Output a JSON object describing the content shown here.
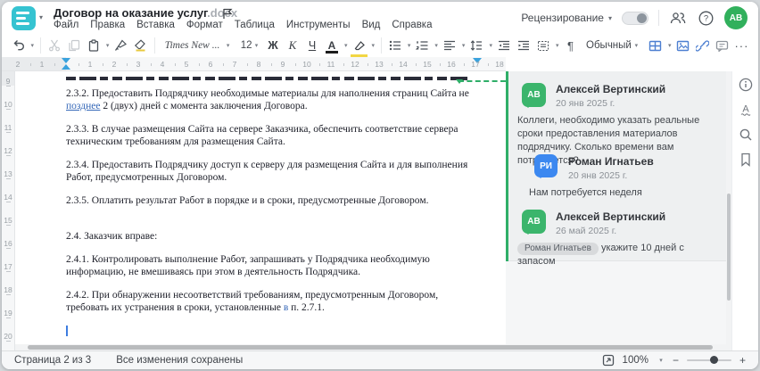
{
  "header": {
    "title": "Договор на оказание услуг",
    "title_extension": ".docx",
    "menu": [
      "Файл",
      "Правка",
      "Вставка",
      "Формат",
      "Таблица",
      "Инструменты",
      "Вид",
      "Справка"
    ],
    "review_label": "Рецензирование",
    "avatar_initials": "АВ"
  },
  "toolbar": {
    "font_name": "Times New ...",
    "font_size": "12",
    "bold_label": "Ж",
    "italic_label": "К",
    "underline_label": "Ч",
    "font_color_label": "А",
    "pilcrow_label": "¶",
    "style_name": "Обычный",
    "more_label": "···",
    "caret_glyph": "▾"
  },
  "ruler": {
    "horizontal_margin_numbers": [
      "2",
      "1"
    ],
    "horizontal_numbers": [
      "1",
      "2",
      "3",
      "4",
      "5",
      "6",
      "7",
      "8",
      "9",
      "10",
      "11",
      "12",
      "13",
      "14",
      "15",
      "16",
      "17",
      "18"
    ],
    "vertical_numbers": [
      "9",
      "10",
      "11",
      "12",
      "13",
      "14",
      "15",
      "16",
      "17",
      "18",
      "19",
      "20"
    ]
  },
  "document": {
    "para_232": {
      "pre": "2.3.2. Предоставить Подрядчику необходимые материалы для наполнения страниц Сайта не ",
      "inserted": "позднее",
      "post": " 2 (двух) дней с момента заключения Договора."
    },
    "para_233": "2.3.3. В случае размещения Сайта на сервере Заказчика, обеспечить соответствие сервера техническим требованиям для размещения Сайта.",
    "para_234": "2.3.4. Предоставить Подрядчику доступ к серверу для размещения Сайта и для выполнения Работ, предусмотренных Договором.",
    "para_235": "2.3.5. Оплатить результат Работ в порядке и в сроки, предусмотренные Договором.",
    "para_24": "2.4. Заказчик вправе:",
    "para_241": "2.4.1. Контролировать выполнение Работ, запрашивать у Подрядчика необходимую информацию, не вмешиваясь при этом в деятельность Подрядчика.",
    "para_242": {
      "pre": "2.4.2. При обнаружении несоответствий требованиям, предусмотренным Договором, требовать их устранения в сроки, установленные ",
      "inserted": "в",
      "post": " п. 2.7.1."
    }
  },
  "comments": {
    "thread1": {
      "author_initials": "АВ",
      "author_name": "Алексей Вертинский",
      "date": "20 янв 2025 г.",
      "text": "Коллеги, необходимо указать реальные сроки предоставления материалов подрядчику. Сколько времени вам потребуется?",
      "reply_initials": "РИ",
      "reply_name": "Роман Игнатьев",
      "reply_date": "20 янв 2025 г.",
      "reply_text": "Нам потребуется неделя"
    },
    "thread2": {
      "author_initials": "АВ",
      "author_name": "Алексей Вертинский",
      "date": "26 май 2025 г.",
      "mention": "Роман Игнатьев",
      "text": " укажите 10 дней с запасом"
    }
  },
  "status_bar": {
    "page_indicator": "Страница 2 из 3",
    "save_status": "Все изменения сохранены",
    "zoom_value": "100%",
    "zoom_minus": "−",
    "zoom_plus": "+"
  },
  "colors": {
    "accent_teal": "#35c3d1",
    "avatar_green": "#31b05c",
    "comment_green": "#3bb56c",
    "comment_blue": "#3c88f0",
    "toolbar_blue": "#4d7fd1",
    "ruler_marker_blue": "#3aa2dd",
    "comment_anchor_green": "#2fae68",
    "inserted_text_blue": "#3668b8"
  }
}
